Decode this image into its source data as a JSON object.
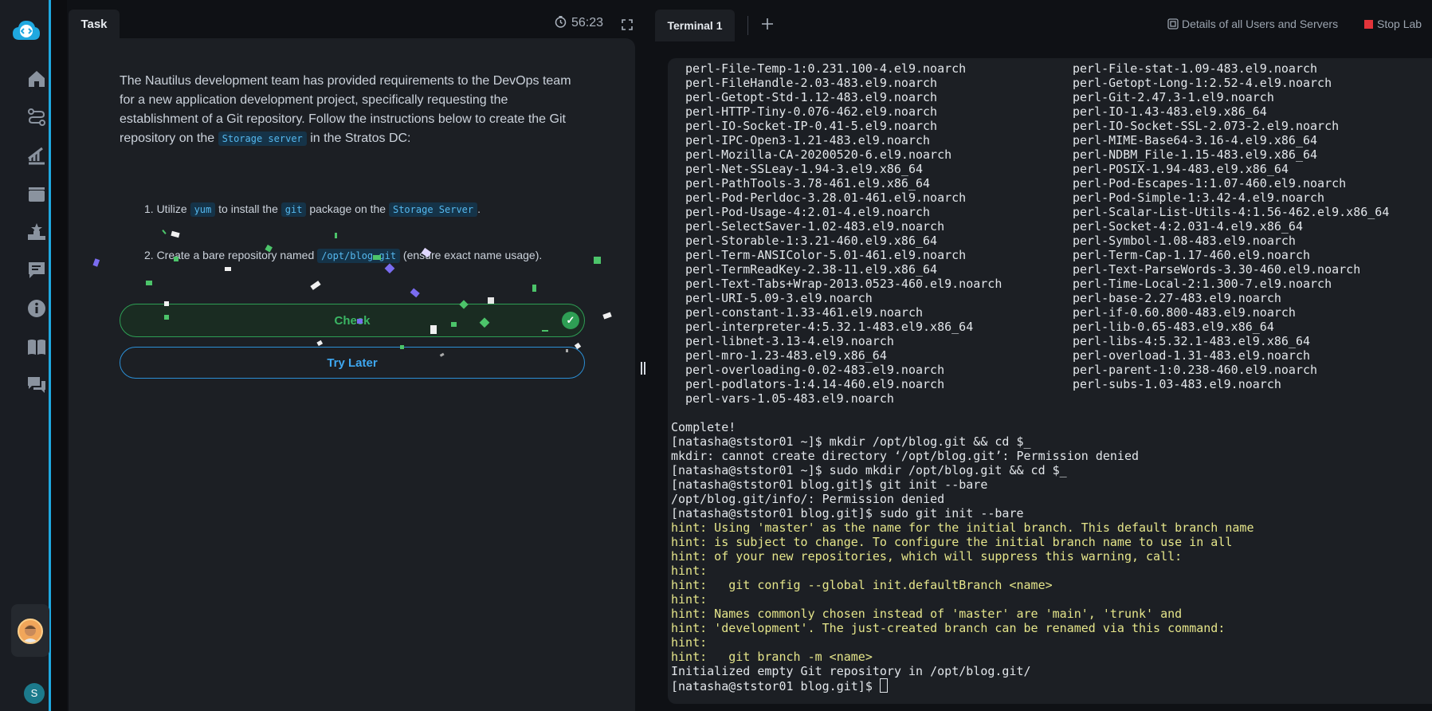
{
  "task": {
    "tab_label": "Task",
    "timer": "56:23",
    "description_parts": [
      "The Nautilus development team has provided requirements to the DevOps team for a new application development project, specifically requesting the establishment of a Git repository. Follow the instructions below to create the Git repository on the ",
      "Storage server",
      " in the Stratos DC:"
    ],
    "steps": [
      {
        "parts": [
          "1. Utilize ",
          "yum",
          " to install the ",
          "git",
          " package on the ",
          "Storage Server",
          "."
        ]
      },
      {
        "parts": [
          "2. Create a bare repository named ",
          "/opt/blog.git",
          " (ensure exact name usage)."
        ]
      }
    ],
    "check_label": "Check",
    "try_later_label": "Try Later"
  },
  "terminal": {
    "tab_label": "Terminal 1",
    "details_label": "Details of all Users and Servers",
    "stop_label": "Stop Lab",
    "package_rows": [
      [
        "perl-File-Temp-1:0.231.100-4.el9.noarch",
        "perl-File-stat-1.09-483.el9.noarch"
      ],
      [
        "perl-FileHandle-2.03-483.el9.noarch",
        "perl-Getopt-Long-1:2.52-4.el9.noarch"
      ],
      [
        "perl-Getopt-Std-1.12-483.el9.noarch",
        "perl-Git-2.47.3-1.el9.noarch"
      ],
      [
        "perl-HTTP-Tiny-0.076-462.el9.noarch",
        "perl-IO-1.43-483.el9.x86_64"
      ],
      [
        "perl-IO-Socket-IP-0.41-5.el9.noarch",
        "perl-IO-Socket-SSL-2.073-2.el9.noarch"
      ],
      [
        "perl-IPC-Open3-1.21-483.el9.noarch",
        "perl-MIME-Base64-3.16-4.el9.x86_64"
      ],
      [
        "perl-Mozilla-CA-20200520-6.el9.noarch",
        "perl-NDBM_File-1.15-483.el9.x86_64"
      ],
      [
        "perl-Net-SSLeay-1.94-3.el9.x86_64",
        "perl-POSIX-1.94-483.el9.x86_64"
      ],
      [
        "perl-PathTools-3.78-461.el9.x86_64",
        "perl-Pod-Escapes-1:1.07-460.el9.noarch"
      ],
      [
        "perl-Pod-Perldoc-3.28.01-461.el9.noarch",
        "perl-Pod-Simple-1:3.42-4.el9.noarch"
      ],
      [
        "perl-Pod-Usage-4:2.01-4.el9.noarch",
        "perl-Scalar-List-Utils-4:1.56-462.el9.x86_64"
      ],
      [
        "perl-SelectSaver-1.02-483.el9.noarch",
        "perl-Socket-4:2.031-4.el9.x86_64"
      ],
      [
        "perl-Storable-1:3.21-460.el9.x86_64",
        "perl-Symbol-1.08-483.el9.noarch"
      ],
      [
        "perl-Term-ANSIColor-5.01-461.el9.noarch",
        "perl-Term-Cap-1.17-460.el9.noarch"
      ],
      [
        "perl-TermReadKey-2.38-11.el9.x86_64",
        "perl-Text-ParseWords-3.30-460.el9.noarch"
      ],
      [
        "perl-Text-Tabs+Wrap-2013.0523-460.el9.noarch",
        "perl-Time-Local-2:1.300-7.el9.noarch"
      ],
      [
        "perl-URI-5.09-3.el9.noarch",
        "perl-base-2.27-483.el9.noarch"
      ],
      [
        "perl-constant-1.33-461.el9.noarch",
        "perl-if-0.60.800-483.el9.noarch"
      ],
      [
        "perl-interpreter-4:5.32.1-483.el9.x86_64",
        "perl-lib-0.65-483.el9.x86_64"
      ],
      [
        "perl-libnet-3.13-4.el9.noarch",
        "perl-libs-4:5.32.1-483.el9.x86_64"
      ],
      [
        "perl-mro-1.23-483.el9.x86_64",
        "perl-overload-1.31-483.el9.noarch"
      ],
      [
        "perl-overloading-0.02-483.el9.noarch",
        "perl-parent-1:0.238-460.el9.noarch"
      ],
      [
        "perl-podlators-1:4.14-460.el9.noarch",
        "perl-subs-1.03-483.el9.noarch"
      ],
      [
        "perl-vars-1.05-483.el9.noarch",
        ""
      ]
    ],
    "output_lines": [
      {
        "text": "",
        "type": "normal"
      },
      {
        "text": "Complete!",
        "type": "normal"
      },
      {
        "text": "[natasha@ststor01 ~]$ mkdir /opt/blog.git && cd $_",
        "type": "normal"
      },
      {
        "text": "mkdir: cannot create directory ‘/opt/blog.git’: Permission denied",
        "type": "normal"
      },
      {
        "text": "[natasha@ststor01 ~]$ sudo mkdir /opt/blog.git && cd $_",
        "type": "normal"
      },
      {
        "text": "[natasha@ststor01 blog.git]$ git init --bare",
        "type": "normal"
      },
      {
        "text": "/opt/blog.git/info/: Permission denied",
        "type": "normal"
      },
      {
        "text": "[natasha@ststor01 blog.git]$ sudo git init --bare",
        "type": "normal"
      },
      {
        "text": "hint: Using 'master' as the name for the initial branch. This default branch name",
        "type": "hint"
      },
      {
        "text": "hint: is subject to change. To configure the initial branch name to use in all",
        "type": "hint"
      },
      {
        "text": "hint: of your new repositories, which will suppress this warning, call:",
        "type": "hint"
      },
      {
        "text": "hint:",
        "type": "hint"
      },
      {
        "text": "hint:   git config --global init.defaultBranch <name>",
        "type": "hint"
      },
      {
        "text": "hint:",
        "type": "hint"
      },
      {
        "text": "hint: Names commonly chosen instead of 'master' are 'main', 'trunk' and",
        "type": "hint"
      },
      {
        "text": "hint: 'development'. The just-created branch can be renamed via this command:",
        "type": "hint"
      },
      {
        "text": "hint:",
        "type": "hint"
      },
      {
        "text": "hint:   git branch -m <name>",
        "type": "hint"
      },
      {
        "text": "Initialized empty Git repository in /opt/blog.git/",
        "type": "normal"
      }
    ],
    "prompt": "[natasha@ststor01 blog.git]$ "
  },
  "sidebar": {
    "user_initial": "S",
    "icons": [
      "home-icon",
      "route-icon",
      "progress-icon",
      "film-icon",
      "leaderboard-icon",
      "feedback-icon",
      "info-icon",
      "book-icon",
      "chat-icon"
    ]
  },
  "colors": {
    "accent_blue": "#1fa8e0",
    "check_green": "#3bb664",
    "hint_yellow": "#e5e58a",
    "stop_red": "#e3343a"
  }
}
